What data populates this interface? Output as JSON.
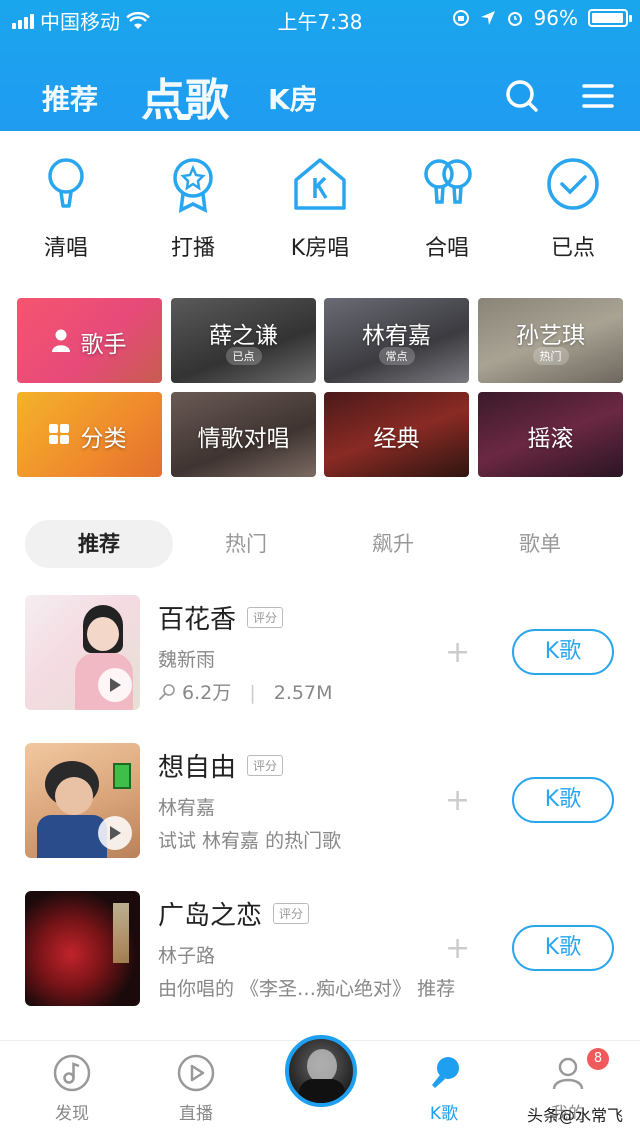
{
  "status": {
    "carrier": "中国移动",
    "time": "上午7:38",
    "battery": "96%",
    "battery_level": 0.96
  },
  "topnav": {
    "tabs": [
      "推荐",
      "点歌",
      "K房"
    ],
    "active": 1
  },
  "quick_actions": [
    "清唱",
    "打播",
    "K房唱",
    "合唱",
    "已点"
  ],
  "tiles": {
    "row1": [
      {
        "name": "歌手",
        "tag": ""
      },
      {
        "name": "薛之谦",
        "tag": "已点"
      },
      {
        "name": "林宥嘉",
        "tag": "常点"
      },
      {
        "name": "孙艺琪",
        "tag": "热门"
      }
    ],
    "row2": [
      {
        "name": "分类",
        "tag": ""
      },
      {
        "name": "情歌对唱",
        "tag": ""
      },
      {
        "name": "经典",
        "tag": ""
      },
      {
        "name": "摇滚",
        "tag": ""
      }
    ]
  },
  "segments": [
    "推荐",
    "热门",
    "飙升",
    "歌单"
  ],
  "songs": [
    {
      "title": "百花香",
      "score": "评分",
      "artist": "魏新雨",
      "meta": "6.2万",
      "size": "2.57M",
      "button": "K歌",
      "plus": "+"
    },
    {
      "title": "想自由",
      "score": "评分",
      "artist": "林宥嘉",
      "meta": "试试 林宥嘉 的热门歌",
      "button": "K歌",
      "plus": "+"
    },
    {
      "title": "广岛之恋",
      "score": "评分",
      "artist": "林子路",
      "meta": "由你唱的 《李圣…痴心绝对》 推荐",
      "button": "K歌",
      "plus": "+"
    }
  ],
  "bottombar": {
    "items": [
      "发现",
      "直播",
      "",
      "K歌",
      "我的"
    ],
    "badge": "8",
    "watermark": "头条@水常飞"
  },
  "colors": {
    "accent": "#1e9ff0",
    "badge": "#f05a5a"
  }
}
